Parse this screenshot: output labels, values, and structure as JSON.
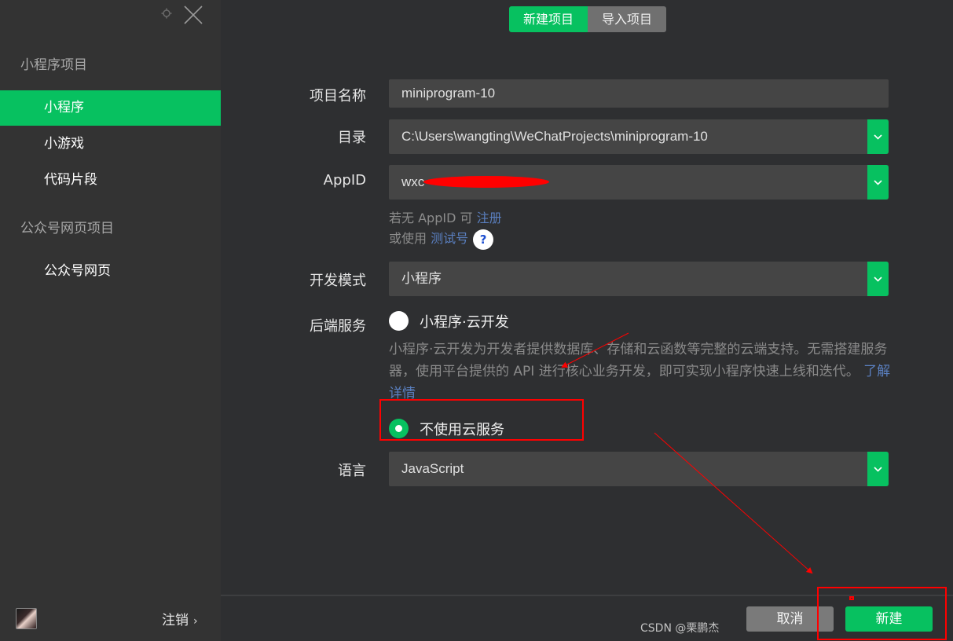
{
  "sidebar": {
    "groups": [
      {
        "title": "小程序项目",
        "items": [
          {
            "label": "小程序",
            "active": true
          },
          {
            "label": "小游戏",
            "active": false
          },
          {
            "label": "代码片段",
            "active": false
          }
        ]
      },
      {
        "title": "公众号网页项目",
        "items": [
          {
            "label": "公众号网页",
            "active": false
          }
        ]
      }
    ],
    "logout_label": "注销",
    "logout_chevron": "›"
  },
  "tabs": [
    {
      "label": "新建项目",
      "active": true
    },
    {
      "label": "导入项目",
      "active": false
    }
  ],
  "form": {
    "project_name": {
      "label": "项目名称",
      "value": "miniprogram-10"
    },
    "directory": {
      "label": "目录",
      "value": "C:\\Users\\wangting\\WeChatProjects\\miniprogram-10"
    },
    "appid": {
      "label": "AppID",
      "value": "wxc",
      "hint_prefix": "若无 AppID 可 ",
      "hint_link": "注册",
      "hint2_prefix": "或使用 ",
      "hint2_link": "测试号",
      "help_icon": "?"
    },
    "dev_mode": {
      "label": "开发模式",
      "value": "小程序"
    },
    "backend": {
      "label": "后端服务",
      "options": [
        {
          "label": "小程序·云开发",
          "selected": false
        },
        {
          "label": "不使用云服务",
          "selected": true
        }
      ],
      "description": "小程序·云开发为开发者提供数据库、存储和云函数等完整的云端支持。无需搭建服务器，使用平台提供的 API 进行核心业务开发，即可实现小程序快速上线和迭代。",
      "learn_more": "了解详情"
    },
    "language": {
      "label": "语言",
      "value": "JavaScript"
    }
  },
  "footer": {
    "cancel_label": "取消",
    "create_label": "新建"
  },
  "watermark": "CSDN @栗鹏杰",
  "colors": {
    "accent": "#07c160",
    "annotation": "#ff0000",
    "link": "#5a7fbf"
  }
}
